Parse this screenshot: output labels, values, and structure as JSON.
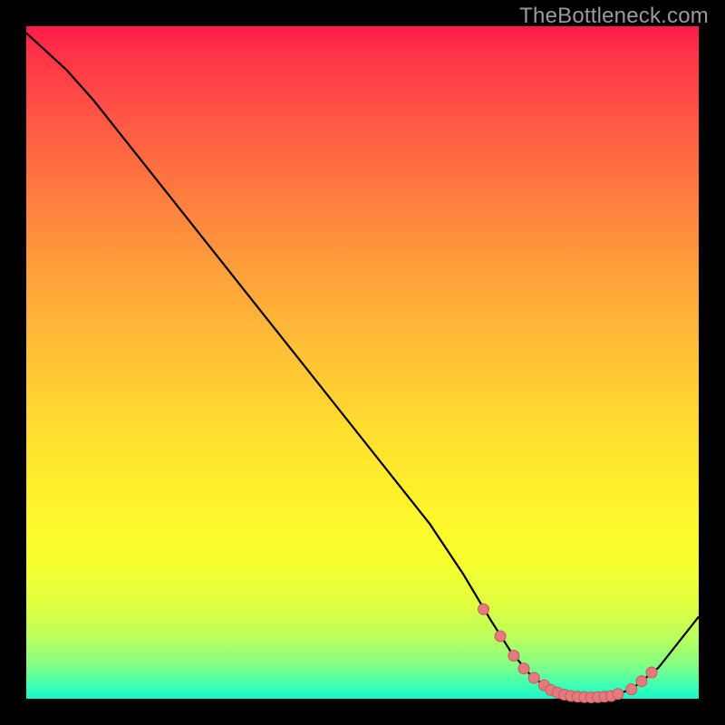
{
  "watermark": "TheBottleneck.com",
  "colors": {
    "background": "#000000",
    "curve_stroke": "#000000",
    "marker_fill": "#e37a7d",
    "marker_stroke": "#c95a5e"
  },
  "chart_data": {
    "type": "line",
    "title": "",
    "xlabel": "",
    "ylabel": "",
    "xlim": [
      0,
      100
    ],
    "ylim": [
      0,
      100
    ],
    "grid": false,
    "legend": false,
    "series": [
      {
        "name": "curve",
        "x": [
          0,
          6,
          10,
          20,
          30,
          40,
          50,
          60,
          65,
          69,
          72,
          75,
          78,
          81,
          84,
          87,
          90,
          94,
          100
        ],
        "y": [
          99,
          93.5,
          89,
          76.4,
          63.8,
          51.2,
          38.6,
          26,
          18.5,
          11.8,
          7.1,
          3.5,
          1.3,
          0.4,
          0.2,
          0.4,
          1.4,
          4.6,
          12.2
        ]
      }
    ],
    "markers": {
      "name": "highlight-points",
      "x": [
        68,
        70.5,
        72.5,
        74,
        75.5,
        77,
        78,
        79,
        80,
        81,
        82,
        83,
        84,
        85,
        86,
        87,
        88,
        90,
        91.5,
        93
      ],
      "y": [
        13.3,
        9.3,
        6.4,
        4.5,
        3.1,
        2.0,
        1.3,
        0.9,
        0.6,
        0.4,
        0.3,
        0.24,
        0.2,
        0.23,
        0.3,
        0.4,
        0.7,
        1.4,
        2.6,
        3.9
      ]
    }
  }
}
